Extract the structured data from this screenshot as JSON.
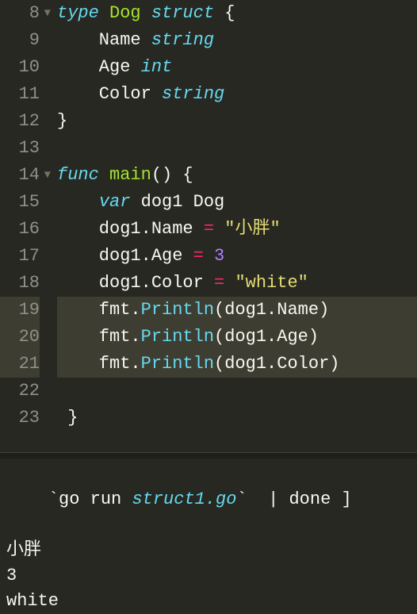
{
  "editor": {
    "lines": [
      {
        "num": "8",
        "fold": true,
        "hl": false,
        "tokens": [
          {
            "t": "type",
            "cls": "tok-keyword"
          },
          {
            "t": " ",
            "cls": ""
          },
          {
            "t": "Dog",
            "cls": "tok-type"
          },
          {
            "t": " ",
            "cls": ""
          },
          {
            "t": "struct",
            "cls": "tok-typedef"
          },
          {
            "t": " {",
            "cls": "tok-punc"
          }
        ]
      },
      {
        "num": "9",
        "fold": false,
        "hl": false,
        "tokens": [
          {
            "t": "    Name ",
            "cls": "tok-ident"
          },
          {
            "t": "string",
            "cls": "tok-fieldtype"
          }
        ]
      },
      {
        "num": "10",
        "fold": false,
        "hl": false,
        "tokens": [
          {
            "t": "    Age ",
            "cls": "tok-ident"
          },
          {
            "t": "int",
            "cls": "tok-fieldtype"
          }
        ]
      },
      {
        "num": "11",
        "fold": false,
        "hl": false,
        "tokens": [
          {
            "t": "    Color ",
            "cls": "tok-ident"
          },
          {
            "t": "string",
            "cls": "tok-fieldtype"
          }
        ]
      },
      {
        "num": "12",
        "fold": false,
        "hl": false,
        "tokens": [
          {
            "t": "}",
            "cls": "tok-punc"
          }
        ]
      },
      {
        "num": "13",
        "fold": false,
        "hl": false,
        "tokens": []
      },
      {
        "num": "14",
        "fold": true,
        "hl": false,
        "tokens": [
          {
            "t": "func",
            "cls": "tok-keyword"
          },
          {
            "t": " ",
            "cls": ""
          },
          {
            "t": "main",
            "cls": "tok-funcname"
          },
          {
            "t": "() {",
            "cls": "tok-punc"
          }
        ]
      },
      {
        "num": "15",
        "fold": false,
        "hl": false,
        "tokens": [
          {
            "t": "    ",
            "cls": ""
          },
          {
            "t": "var",
            "cls": "tok-var"
          },
          {
            "t": " dog1 Dog",
            "cls": "tok-ident"
          }
        ]
      },
      {
        "num": "16",
        "fold": false,
        "hl": false,
        "tokens": [
          {
            "t": "    dog1.Name ",
            "cls": "tok-ident"
          },
          {
            "t": "=",
            "cls": "tok-op"
          },
          {
            "t": " ",
            "cls": ""
          },
          {
            "t": "\"小胖\"",
            "cls": "tok-string"
          }
        ]
      },
      {
        "num": "17",
        "fold": false,
        "hl": false,
        "tokens": [
          {
            "t": "    dog1.Age ",
            "cls": "tok-ident"
          },
          {
            "t": "=",
            "cls": "tok-op"
          },
          {
            "t": " ",
            "cls": ""
          },
          {
            "t": "3",
            "cls": "tok-num"
          }
        ]
      },
      {
        "num": "18",
        "fold": false,
        "hl": false,
        "tokens": [
          {
            "t": "    dog1.Color ",
            "cls": "tok-ident"
          },
          {
            "t": "=",
            "cls": "tok-op"
          },
          {
            "t": " ",
            "cls": ""
          },
          {
            "t": "\"white\"",
            "cls": "tok-string"
          }
        ]
      },
      {
        "num": "19",
        "fold": false,
        "hl": true,
        "tokens": [
          {
            "t": "    fmt.",
            "cls": "tok-ident"
          },
          {
            "t": "Println",
            "cls": "tok-call"
          },
          {
            "t": "(dog1.Name)",
            "cls": "tok-ident"
          }
        ]
      },
      {
        "num": "20",
        "fold": false,
        "hl": true,
        "tokens": [
          {
            "t": "    fmt.",
            "cls": "tok-ident"
          },
          {
            "t": "Println",
            "cls": "tok-call"
          },
          {
            "t": "(dog1.Age)",
            "cls": "tok-ident"
          }
        ]
      },
      {
        "num": "21",
        "fold": false,
        "hl": true,
        "tokens": [
          {
            "t": "    fmt.",
            "cls": "tok-ident"
          },
          {
            "t": "Println",
            "cls": "tok-call"
          },
          {
            "t": "(dog1.Color)",
            "cls": "tok-ident"
          }
        ]
      },
      {
        "num": "22",
        "fold": false,
        "hl": false,
        "tokens": []
      },
      {
        "num": "23",
        "fold": false,
        "hl": false,
        "tokens": [
          {
            "t": " }",
            "cls": "tok-punc"
          }
        ]
      },
      {
        "num": "",
        "fold": false,
        "hl": false,
        "tokens": []
      }
    ]
  },
  "terminal": {
    "cmd_prefix": "`go run ",
    "cmd_file": "struct1.go",
    "cmd_suffix": "`  | done ]",
    "output": [
      "小胖",
      "3",
      "white"
    ]
  }
}
